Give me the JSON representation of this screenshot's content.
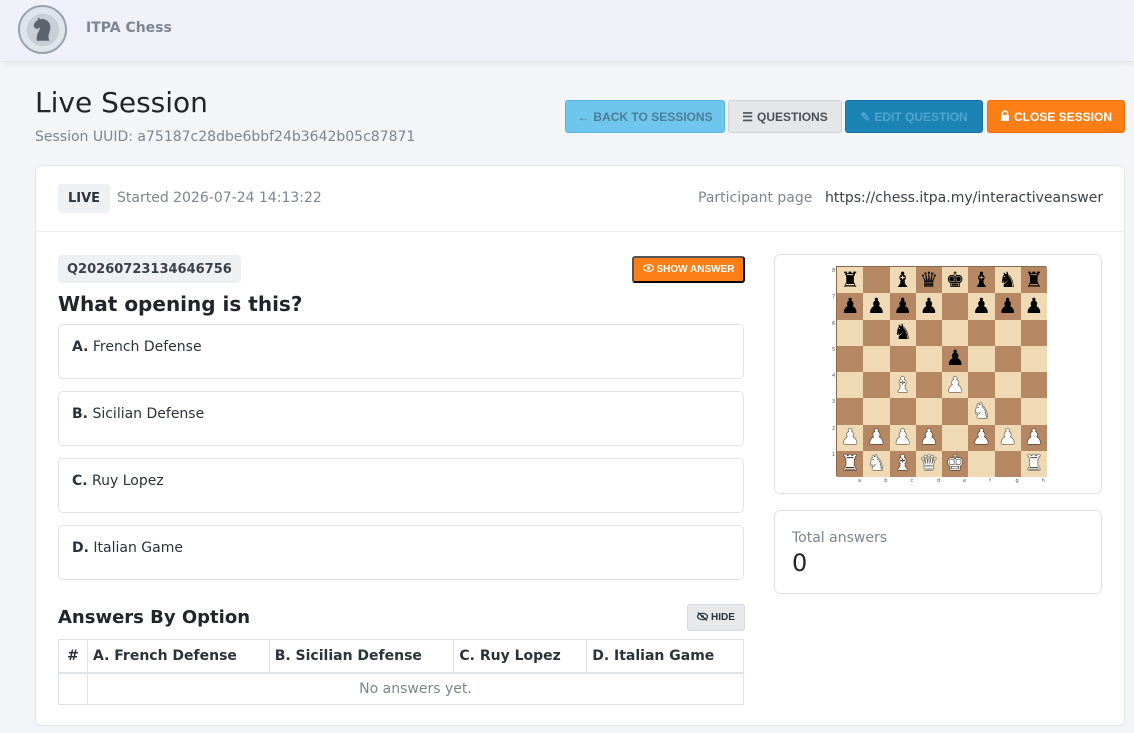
{
  "app": {
    "brand": "ITPA Chess"
  },
  "header": {
    "title": "Live Session",
    "uuid_text": "Session UUID: a75187c28dbe6bbf24b3642b05c87871"
  },
  "toolbar": {
    "back_label": "BACK TO SESSIONS",
    "questions_label": "QUESTIONS",
    "edit_label": "EDIT QUESTION",
    "close_label": "CLOSE SESSION"
  },
  "session": {
    "status_badge": "LIVE",
    "started": "Started 2026-07-24 14:13:22",
    "participant_label": "Participant page",
    "participant_url": "https://chess.itpa.my/interactiveanswer"
  },
  "question": {
    "id": "Q20260723134646756",
    "show_answer_label": "SHOW ANSWER",
    "text": "What opening is this?",
    "options": [
      {
        "letter": "A.",
        "text": "French Defense"
      },
      {
        "letter": "B.",
        "text": "Sicilian Defense"
      },
      {
        "letter": "C.",
        "text": "Ruy Lopez"
      },
      {
        "letter": "D.",
        "text": "Italian Game"
      }
    ]
  },
  "answers": {
    "title": "Answers By Option",
    "hide_label": "HIDE",
    "columns": [
      "#",
      "A. French Defense",
      "B. Sicilian Defense",
      "C. Ruy Lopez",
      "D. Italian Game"
    ],
    "empty_text": "No answers yet."
  },
  "board": {
    "ranks": [
      [
        "bR",
        "",
        "bB",
        "bQ",
        "bK",
        "bB",
        "bN",
        "bR"
      ],
      [
        "bP",
        "bP",
        "bP",
        "bP",
        "",
        "bP",
        "bP",
        "bP"
      ],
      [
        "",
        "",
        "bN",
        "",
        "",
        "",
        "",
        ""
      ],
      [
        "",
        "",
        "",
        "",
        "bP",
        "",
        "",
        ""
      ],
      [
        "",
        "",
        "wB",
        "",
        "wP",
        "",
        "",
        ""
      ],
      [
        "",
        "",
        "",
        "",
        "",
        "wN",
        "",
        ""
      ],
      [
        "wP",
        "wP",
        "wP",
        "wP",
        "",
        "wP",
        "wP",
        "wP"
      ],
      [
        "wR",
        "wN",
        "wB",
        "wQ",
        "wK",
        "",
        "",
        "wR"
      ]
    ],
    "rank_labels": [
      "8",
      "7",
      "6",
      "5",
      "4",
      "3",
      "2",
      "1"
    ],
    "file_labels": [
      "a",
      "b",
      "c",
      "d",
      "e",
      "f",
      "g",
      "h"
    ]
  },
  "stats": {
    "total_label": "Total answers",
    "total_value": "0"
  },
  "colors": {
    "accent_orange": "#fd7e14",
    "info_blue": "#6ec6ec",
    "primary_blue": "#1b84b5",
    "board_light": "#f0d9b5",
    "board_dark": "#b58863"
  }
}
